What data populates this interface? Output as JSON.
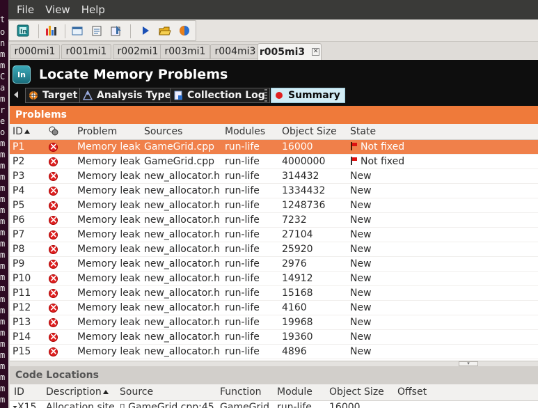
{
  "terminal_glyphs": [
    "t",
    "o",
    "n",
    "m",
    "m",
    "C",
    "a",
    "m",
    "r",
    "e",
    "o",
    "m",
    "m",
    "m",
    "m",
    "m",
    "m",
    "m",
    "m",
    "m",
    "m",
    "m",
    "m",
    "m",
    "m",
    "m",
    "m",
    "m",
    "m",
    "m",
    "m",
    "m",
    "m",
    "m",
    "m",
    "m",
    "m",
    "m",
    "m",
    "m",
    "m",
    "m"
  ],
  "menubar": {
    "items": [
      "File",
      "View",
      "Help"
    ]
  },
  "toolbar": {
    "icons": [
      "new-project-icon",
      "bar-chart-icon",
      "open-project-icon",
      "new-analysis-icon",
      "import-result-icon",
      "play-icon",
      "open-folder-icon",
      "compare-icon"
    ]
  },
  "tabs": [
    {
      "label": "r000mi1"
    },
    {
      "label": "r001mi1"
    },
    {
      "label": "r002mi1"
    },
    {
      "label": "r003mi1"
    },
    {
      "label": "r004mi3"
    },
    {
      "label": "r005mi3",
      "active": true
    }
  ],
  "header": {
    "app_icon_text": "In",
    "title": "Locate Memory Problems",
    "nav": {
      "target": "Target",
      "analysis_type": "Analysis Type",
      "collection_log": "Collection Log",
      "summary": "Summary"
    }
  },
  "problems": {
    "section_title": "Problems",
    "columns": {
      "id": "ID",
      "problem": "Problem",
      "sources": "Sources",
      "modules": "Modules",
      "object_size": "Object Size",
      "state": "State"
    },
    "rows": [
      {
        "id": "P1",
        "problem": "Memory leak",
        "source": "GameGrid.cpp",
        "module": "run-life",
        "size": "16000",
        "state": "Not fixed",
        "flag": true,
        "selected": true
      },
      {
        "id": "P2",
        "problem": "Memory leak",
        "source": "GameGrid.cpp",
        "module": "run-life",
        "size": "4000000",
        "state": "Not fixed",
        "flag": true
      },
      {
        "id": "P3",
        "problem": "Memory leak",
        "source": "new_allocator.h",
        "module": "run-life",
        "size": "314432",
        "state": "New"
      },
      {
        "id": "P4",
        "problem": "Memory leak",
        "source": "new_allocator.h",
        "module": "run-life",
        "size": "1334432",
        "state": "New"
      },
      {
        "id": "P5",
        "problem": "Memory leak",
        "source": "new_allocator.h",
        "module": "run-life",
        "size": "1248736",
        "state": "New"
      },
      {
        "id": "P6",
        "problem": "Memory leak",
        "source": "new_allocator.h",
        "module": "run-life",
        "size": "7232",
        "state": "New"
      },
      {
        "id": "P7",
        "problem": "Memory leak",
        "source": "new_allocator.h",
        "module": "run-life",
        "size": "27104",
        "state": "New"
      },
      {
        "id": "P8",
        "problem": "Memory leak",
        "source": "new_allocator.h",
        "module": "run-life",
        "size": "25920",
        "state": "New"
      },
      {
        "id": "P9",
        "problem": "Memory leak",
        "source": "new_allocator.h",
        "module": "run-life",
        "size": "2976",
        "state": "New"
      },
      {
        "id": "P10",
        "problem": "Memory leak",
        "source": "new_allocator.h",
        "module": "run-life",
        "size": "14912",
        "state": "New"
      },
      {
        "id": "P11",
        "problem": "Memory leak",
        "source": "new_allocator.h",
        "module": "run-life",
        "size": "15168",
        "state": "New"
      },
      {
        "id": "P12",
        "problem": "Memory leak",
        "source": "new_allocator.h",
        "module": "run-life",
        "size": "4160",
        "state": "New"
      },
      {
        "id": "P13",
        "problem": "Memory leak",
        "source": "new_allocator.h",
        "module": "run-life",
        "size": "19968",
        "state": "New"
      },
      {
        "id": "P14",
        "problem": "Memory leak",
        "source": "new_allocator.h",
        "module": "run-life",
        "size": "19360",
        "state": "New"
      },
      {
        "id": "P15",
        "problem": "Memory leak",
        "source": "new_allocator.h",
        "module": "run-life",
        "size": "4896",
        "state": "New"
      }
    ]
  },
  "code_locations": {
    "section_title": "Code Locations",
    "columns": {
      "id": "ID",
      "description": "Description",
      "source": "Source",
      "function": "Function",
      "module": "Module",
      "object_size": "Object Size",
      "offset": "Offset"
    },
    "rows": [
      {
        "id": "X15",
        "description": "Allocation site",
        "source": "GameGrid.cpp:45",
        "function": "GameGrid",
        "module": "run-life",
        "size": "16000",
        "offset": ""
      }
    ]
  },
  "colors": {
    "accent_orange": "#ef7a3a",
    "selected_row": "#f0804a",
    "error_red": "#e02020",
    "summary_active": "#d2ecf5"
  }
}
